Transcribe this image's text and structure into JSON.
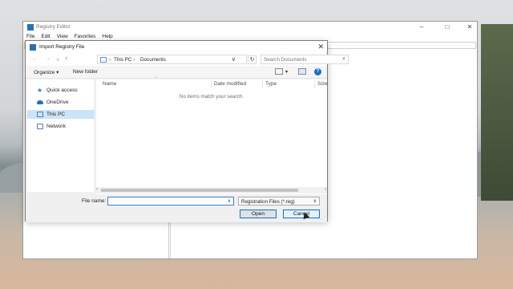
{
  "registry_editor": {
    "title": "Registry Editor",
    "menu": [
      "File",
      "Edit",
      "View",
      "Favorites",
      "Help"
    ]
  },
  "dialog": {
    "title": "Import Registry File",
    "breadcrumb": [
      "This PC",
      "Documents"
    ],
    "search_placeholder": "Search Documents",
    "toolbar": {
      "organize": "Organize ▾",
      "new_folder": "New folder"
    },
    "nav": [
      {
        "label": "Quick access",
        "icon": "star-icon"
      },
      {
        "label": "OneDrive",
        "icon": "cloud-icon"
      },
      {
        "label": "This PC",
        "icon": "computer-icon",
        "selected": true
      },
      {
        "label": "Network",
        "icon": "network-icon"
      }
    ],
    "columns": [
      "Name",
      "Date modified",
      "Type",
      "Size"
    ],
    "empty_message": "No items match your search.",
    "file_name_label": "File name:",
    "file_name_value": "",
    "file_type": "Registration Files (*.reg)",
    "open_label": "Open",
    "cancel_label": "Cancel"
  },
  "colors": {
    "accent": "#0078d7",
    "selected": "#cce4f7"
  }
}
